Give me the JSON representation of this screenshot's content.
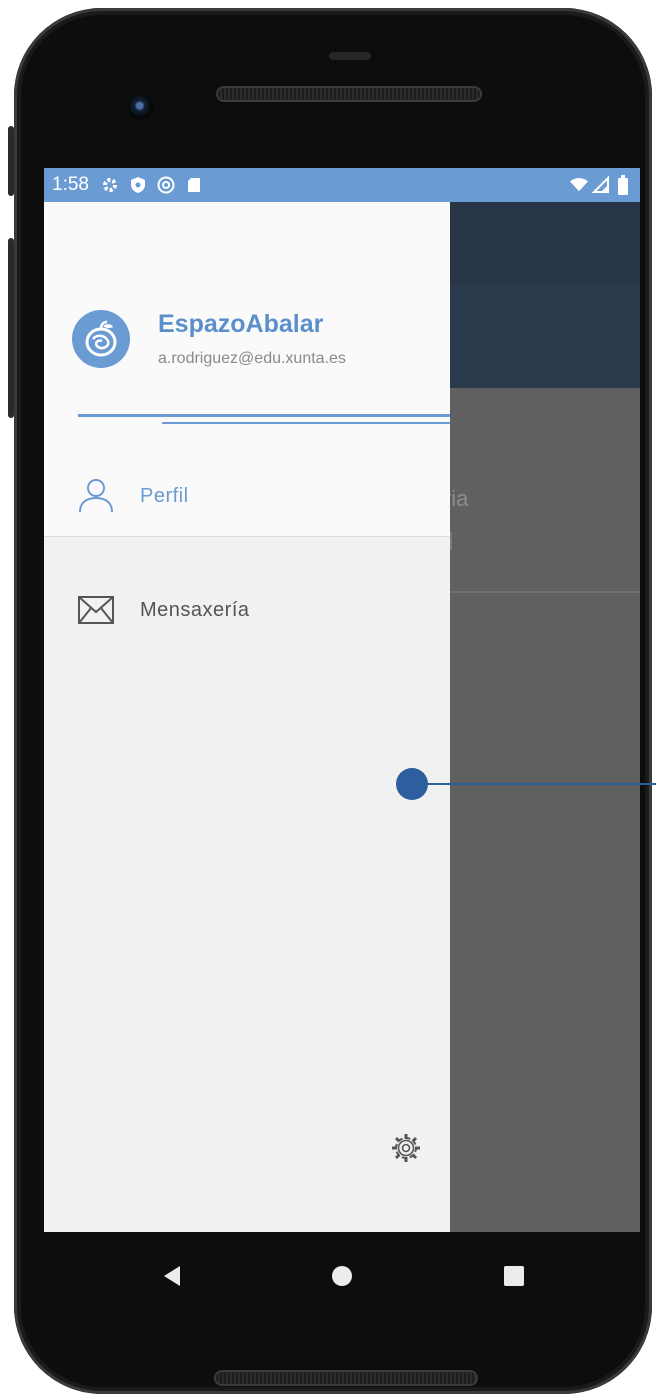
{
  "status_bar": {
    "time": "1:58",
    "left_icons": [
      "settings-icon",
      "shield-icon",
      "at-sign-icon",
      "sd-card-icon"
    ],
    "right_icons": [
      "wifi-icon",
      "signal-icon",
      "battery-icon"
    ],
    "color": "#6a9bd2"
  },
  "drawer": {
    "app_name": "EspazoAbalar",
    "user_email": "a.rodriguez@edu.xunta.es",
    "menu": [
      {
        "label": "Perfil",
        "icon": "person-icon",
        "selected": true
      },
      {
        "label": "Mensaxería",
        "icon": "envelope-icon",
        "selected": false
      }
    ],
    "settings_icon": "gear-icon",
    "accent": "#6a9bd2"
  },
  "background_app": {
    "partial_item_text": "cundaria"
  },
  "nav_bar": {
    "buttons": [
      "back",
      "home",
      "recents"
    ]
  }
}
